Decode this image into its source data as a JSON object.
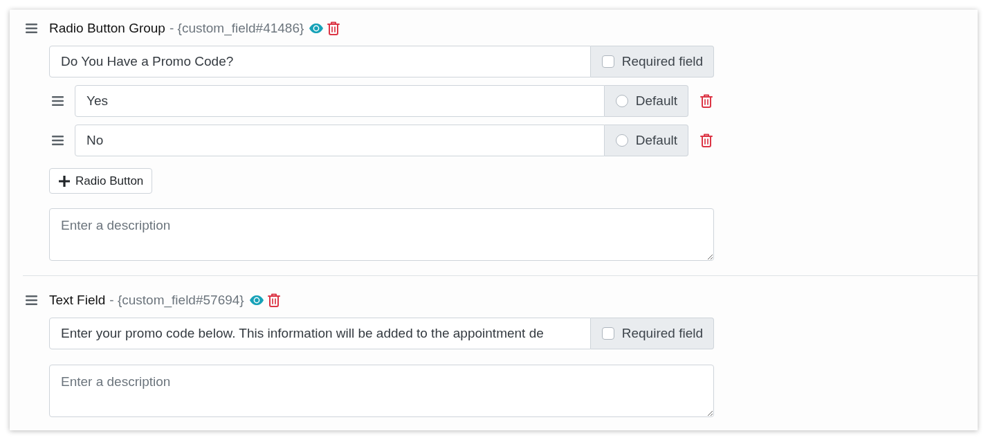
{
  "fields": [
    {
      "kind": "radio_group",
      "type_label": "Radio Button Group",
      "tag": "- {custom_field#41486}",
      "label_value": "Do You Have a Promo Code?",
      "required": {
        "label": "Required field",
        "checked": false
      },
      "options": [
        {
          "value": "Yes",
          "default_label": "Default",
          "selected": false
        },
        {
          "value": "No",
          "default_label": "Default",
          "selected": false
        }
      ],
      "add_button": "Radio Button",
      "description": {
        "placeholder": "Enter a description"
      }
    },
    {
      "kind": "text",
      "type_label": "Text Field",
      "tag": "- {custom_field#57694}",
      "label_value": "Enter your promo code below. This information will be added to the appointment de",
      "required": {
        "label": "Required field",
        "checked": false
      },
      "description": {
        "placeholder": "Enter a description"
      }
    }
  ]
}
